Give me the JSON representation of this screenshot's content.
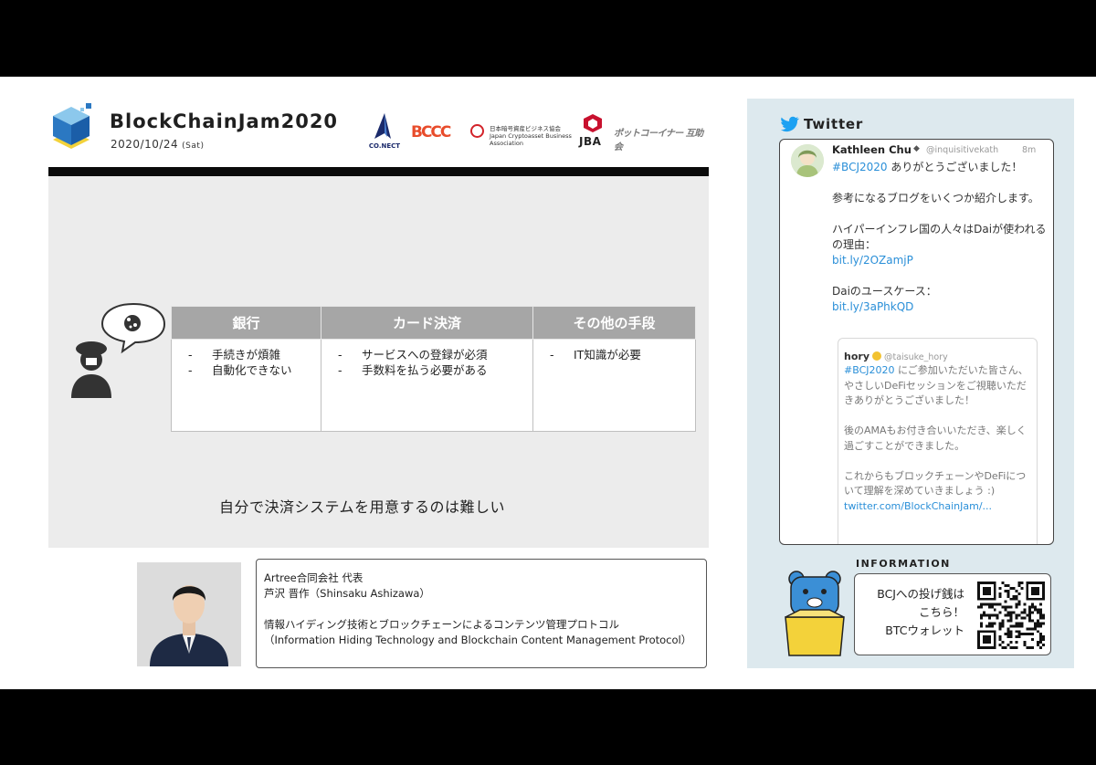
{
  "header": {
    "title": "BlockChainJam2020",
    "date": "2020/10/24",
    "day": "(Sat)"
  },
  "sponsors": {
    "connect": "CO.NECT",
    "bcco": "BCCC",
    "jcba": "日本暗号資産ビジネス協会\nJapan Cryptoasset Business Association",
    "jba": "JBA",
    "other": "ポットコーイナー 互助会"
  },
  "slide": {
    "table": {
      "headers": [
        "銀行",
        "カード決済",
        "その他の手段"
      ],
      "rows": [
        [
          "手続きが煩雑",
          "自動化できない"
        ],
        [
          "サービスへの登録が必須",
          "手数料を払う必要がある"
        ],
        [
          "IT知識が必要"
        ]
      ]
    },
    "caption": "自分で決済システムを用意するのは難しい"
  },
  "speaker": {
    "affiliation": "Artree合同会社 代表",
    "name": "芦沢 晋作（Shinsaku Ashizawa）",
    "talk_ja": "情報ハイディング技術とブロックチェーンによるコンテンツ管理プロトコル",
    "talk_en": "（Information Hiding Technology and Blockchain Content Management Protocol）"
  },
  "twitter": {
    "header": "Twitter",
    "tweet": {
      "name": "Kathleen Chu",
      "verified": "◆",
      "handle": "@inquisitivekath",
      "time": "8m",
      "hashtag": "#BCJ2020",
      "line1": " ありがとうございました！",
      "para2": "参考になるブログをいくつか紹介します。",
      "para3": "ハイパーインフレ国の人々はDaiが使われるの理由：",
      "link1": "bit.ly/2OZamjP",
      "para4": "Daiのユースケース：",
      "link2": "bit.ly/3aPhkQD"
    },
    "quote": {
      "name": "hory",
      "handle": "@taisuke_hory",
      "hashtag": "#BCJ2020",
      "para1": " にご参加いただいた皆さん、やさしいDeFiセッションをご視聴いただきありがとうございました！",
      "para2": "後のAMAもお付き合いいただき、楽しく過ごすことができました。",
      "para3": "これからもブロックチェーンやDeFiについて理解を深めていきましょう :)",
      "link": "twitter.com/BlockChainJam/..."
    }
  },
  "information": {
    "title": "INFORMATION",
    "line1": "BCJへの投げ銭は",
    "line2": "こちら！",
    "line3": "BTCウォレット"
  },
  "colors": {
    "twitter_blue": "#1da1f2",
    "link_blue": "#2a8fd8",
    "table_header": "#a6a6a6",
    "panel_bg": "#dde9ee"
  }
}
